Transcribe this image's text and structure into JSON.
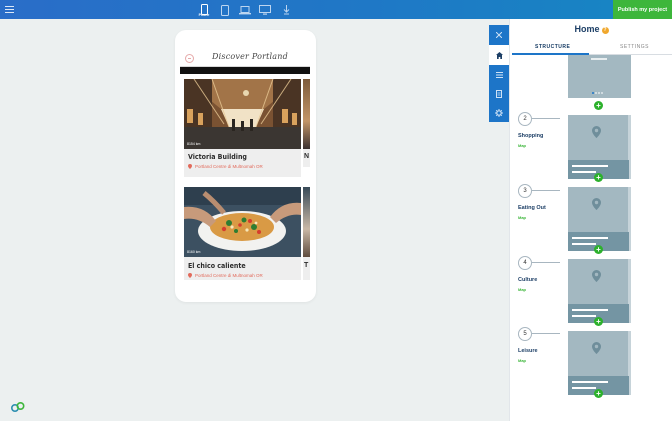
{
  "topbar": {
    "devices": [
      {
        "name": "phone-icon",
        "label": "Phone",
        "active": true
      },
      {
        "name": "tablet-icon",
        "active": false
      },
      {
        "name": "laptop-icon",
        "active": false
      },
      {
        "name": "desktop-icon",
        "active": false
      },
      {
        "name": "download-icon",
        "active": false
      }
    ],
    "publish_label": "Publish my project"
  },
  "phone_preview": {
    "title": "Discover Portland",
    "cards": [
      {
        "title": "Victoria Building",
        "location": "Portland Centre di Multnomah OR",
        "distance": "8154 km"
      },
      {
        "title": "El chico caliente",
        "location": "Portland Centre di Multnomah OR",
        "distance": "8160 km"
      }
    ],
    "peek_cards": [
      {
        "title": "N"
      },
      {
        "title": "T"
      }
    ]
  },
  "side_tabs": [
    "home-icon",
    "list-icon",
    "pages-icon",
    "gear-icon"
  ],
  "panel": {
    "close_icon": "close-icon",
    "title": "Home",
    "help": "?",
    "tabs": [
      {
        "label": "STRUCTURE",
        "active": true
      },
      {
        "label": "SETTINGS",
        "active": false
      }
    ],
    "sections": [
      {
        "number": "2",
        "name": "Shopping",
        "type": "Map"
      },
      {
        "number": "3",
        "name": "Eating Out",
        "type": "Map"
      },
      {
        "number": "4",
        "name": "Culture",
        "type": "Map"
      },
      {
        "number": "5",
        "name": "Leisure",
        "type": "Map"
      }
    ],
    "add_label": "+"
  },
  "colors": {
    "topbar": "#1f78c6",
    "publish": "#3db63b",
    "accent_green": "#2db12d",
    "panel_title": "#1d3f66",
    "location_red": "#e26a5b",
    "thumb": "#a3b8c1"
  }
}
